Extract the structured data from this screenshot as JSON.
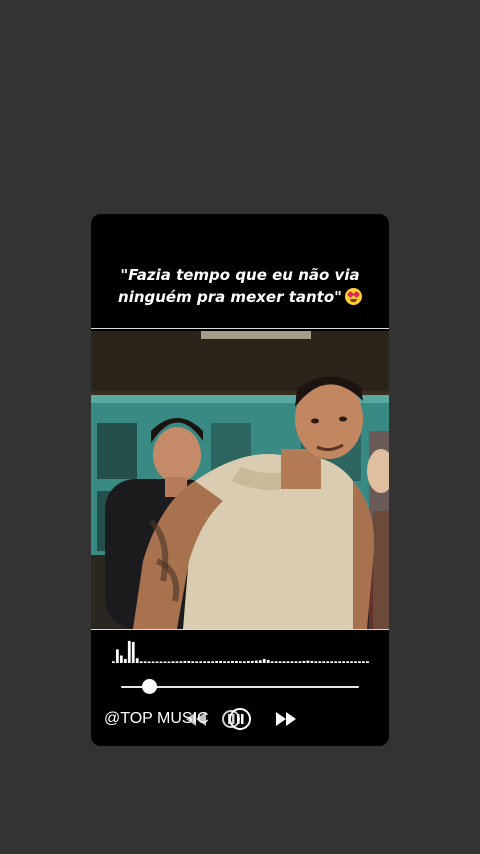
{
  "story": {
    "caption_lines": [
      "\"Fazia tempo que eu não via",
      "ninguém pra mexer tanto\""
    ],
    "caption_emoji": "smiling-face-with-heart-eyes-emoji"
  },
  "player": {
    "handle": "@TOP MUSIC",
    "progress": 0.12,
    "waveform_levels": [
      0.05,
      0.4,
      0.22,
      0.12,
      0.65,
      0.62,
      0.14,
      0.05,
      0.05,
      0.04,
      0.04,
      0.04,
      0.04,
      0.04,
      0.04,
      0.05,
      0.05,
      0.05,
      0.06,
      0.06,
      0.05,
      0.05,
      0.05,
      0.05,
      0.05,
      0.05,
      0.06,
      0.06,
      0.05,
      0.05,
      0.06,
      0.06,
      0.05,
      0.05,
      0.06,
      0.06,
      0.07,
      0.08,
      0.12,
      0.09,
      0.05,
      0.05,
      0.05,
      0.05,
      0.05,
      0.05,
      0.05,
      0.05,
      0.06,
      0.07,
      0.06,
      0.05,
      0.05,
      0.05,
      0.05,
      0.05,
      0.05,
      0.05,
      0.05,
      0.05,
      0.05,
      0.05,
      0.05,
      0.05,
      0.05
    ],
    "controls": [
      "rewind-icon",
      "pause-icon",
      "fast-forward-icon"
    ]
  },
  "colors": {
    "background": "#333333",
    "card": "#000000",
    "text": "#ffffff"
  }
}
